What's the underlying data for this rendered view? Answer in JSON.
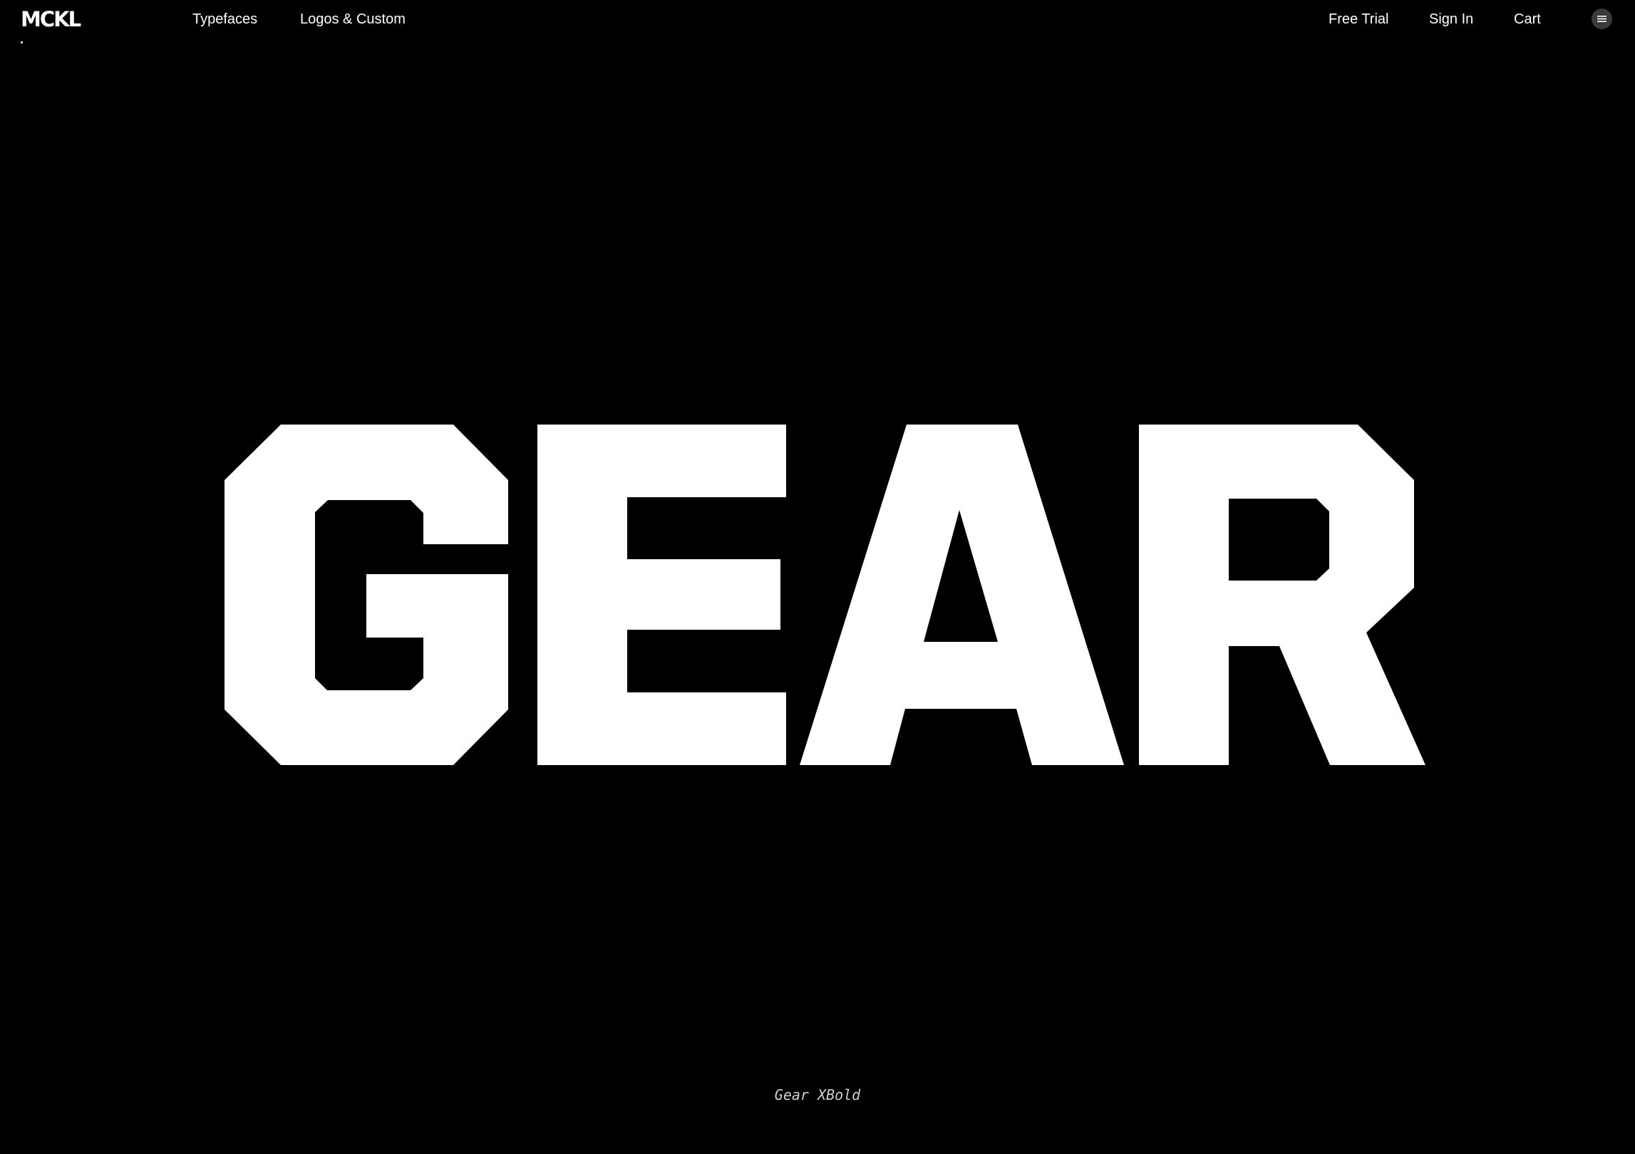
{
  "header": {
    "logo": "MCKL",
    "nav_left": [
      {
        "label": "Typefaces"
      },
      {
        "label": "Logos & Custom"
      }
    ],
    "nav_right": [
      {
        "label": "Free Trial"
      },
      {
        "label": "Sign In"
      },
      {
        "label": "Cart"
      }
    ],
    "menu_icon": "hamburger-menu-icon"
  },
  "specimen": {
    "text": "GEAR",
    "caption": "Gear XBold"
  },
  "colors": {
    "background": "#000000",
    "foreground": "#ffffff",
    "menu_button": "#3a3a3a"
  }
}
